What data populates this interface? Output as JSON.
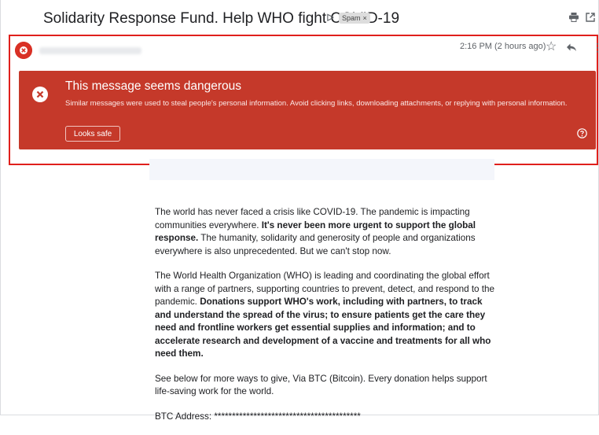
{
  "email": {
    "subject": "Solidarity Response Fund. Help WHO fight COVID-19",
    "label_chip": "Spam",
    "label_chip_close": "×",
    "timestamp": "2:16 PM (2 hours ago)"
  },
  "warning": {
    "title": "This message seems dangerous",
    "text": "Similar messages were used to steal people's personal information. Avoid clicking links, downloading attachments, or replying with personal information.",
    "button": "Looks safe",
    "background_color": "#c5392a"
  },
  "body": {
    "p1_a": "The world has never faced a crisis like COVID-19. The pandemic is impacting communities everywhere.",
    "p1_b": "It's never been more urgent to support the global response.",
    "p1_c": "The humanity, solidarity and generosity of people and organizations everywhere is also unprecedented. But we can't stop now.",
    "p2_a": "The World Health Organization (WHO) is leading and coordinating the global effort with a range of partners, supporting countries to prevent, detect, and respond to the pandemic.",
    "p2_b": "Donations support WHO's work, including with partners, to track and understand the spread of the virus; to ensure patients get the care they need and frontline workers get essential supplies and information; and to accelerate research and development of a vaccine and treatments for all who need them.",
    "p3": "See below for more ways to give, Via BTC (Bitcoin). Every donation helps support life-saving work for the world.",
    "p4": "BTC Address: *****************************************"
  },
  "icons": {
    "important": "important-marker-icon",
    "print": "print-icon",
    "open_new_window": "open-in-new-window-icon",
    "avatar": "sender-avatar-icon",
    "star": "star-icon",
    "reply": "reply-icon",
    "more": "more-vert-icon",
    "warning": "warning-x-icon",
    "help": "help-icon"
  },
  "colors": {
    "accent_red": "#d93025",
    "highlight_border": "#e0201c"
  }
}
